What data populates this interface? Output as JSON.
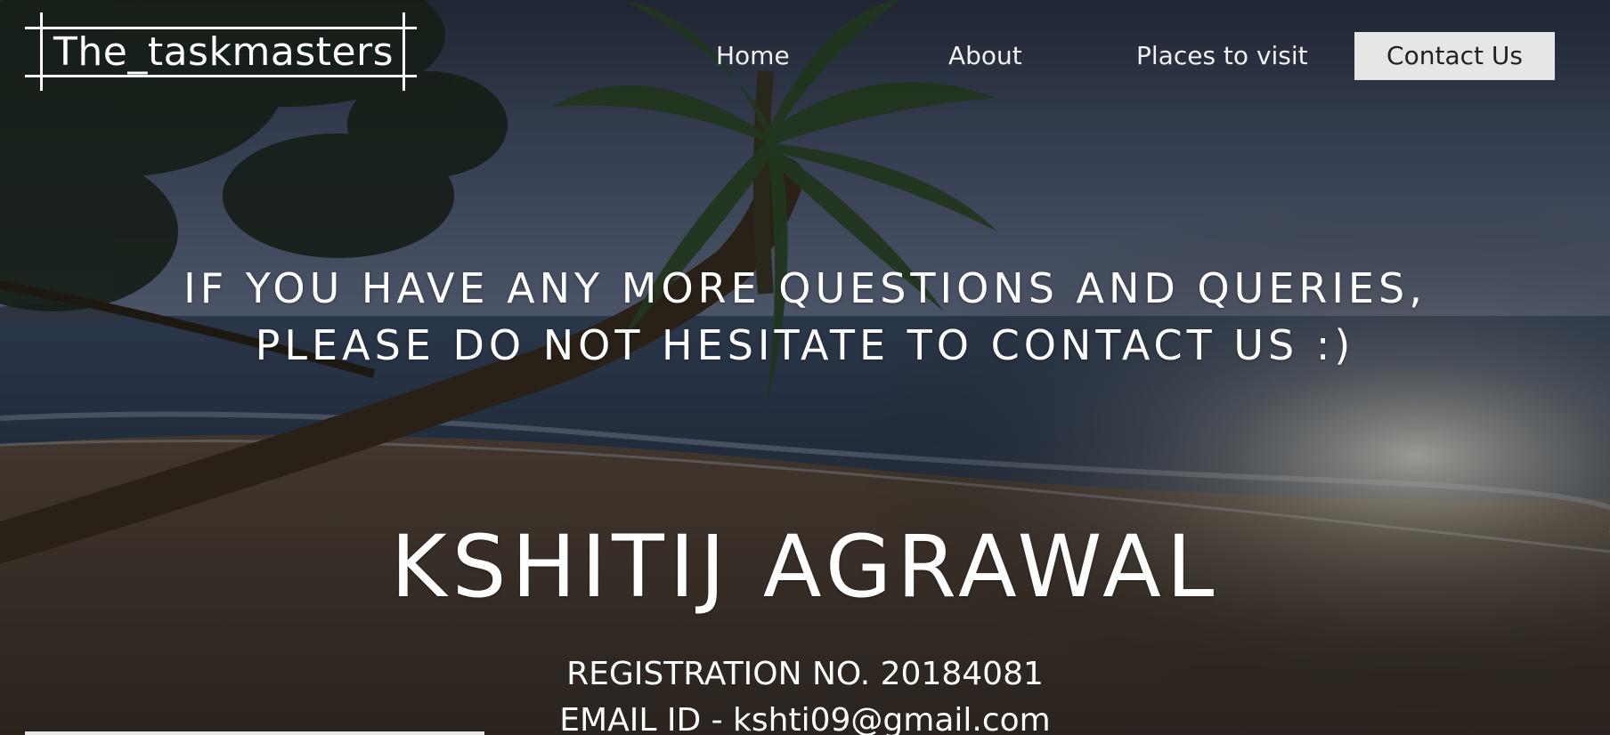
{
  "header": {
    "logo_text": "The_taskmasters"
  },
  "nav": {
    "items": [
      {
        "label": "Home"
      },
      {
        "label": "About"
      },
      {
        "label": "Places to visit"
      },
      {
        "label": "Contact Us",
        "active": true
      }
    ]
  },
  "hero": {
    "tagline_line1": "IF YOU HAVE ANY MORE QUESTIONS AND QUERIES,",
    "tagline_line2": "PLEASE DO NOT HESITATE TO CONTACT US :)",
    "name": "KSHITIJ AGRAWAL",
    "registration": "REGISTRATION NO. 20184081",
    "email": "EMAIL ID - kshti09@gmail.com"
  },
  "background": {
    "scene": "beach with palm tree at dusk",
    "overlay_color": "#000000"
  },
  "colors": {
    "text": "#ffffff",
    "active_nav_bg": "#e6e6e6",
    "active_nav_text": "#222222"
  }
}
